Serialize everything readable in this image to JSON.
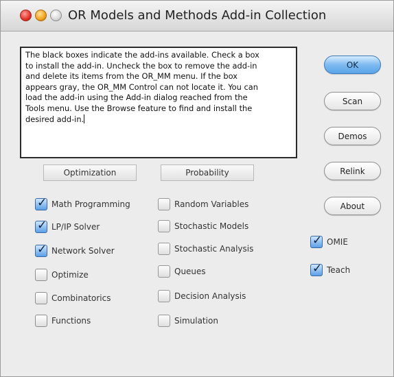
{
  "window": {
    "title": "OR Models and Methods Add-in Collection"
  },
  "info_lines": [
    "The black boxes indicate the add-ins available. Check a box",
    "to install the add-in.  Uncheck the box to remove the add-in",
    "and delete its items from the OR_MM menu.  If the box",
    "appears gray, the OR_MM Control can not locate it. You can",
    "load the add-in using the Add-in dialog reached from the",
    "Tools menu.  Use the Browse feature to find and install the",
    "desired add-in."
  ],
  "groups": {
    "optimization": "Optimization",
    "probability": "Probability"
  },
  "optimization_items": [
    {
      "label": "Math Programming",
      "checked": true
    },
    {
      "label": "LP/IP Solver",
      "checked": true
    },
    {
      "label": "Network Solver",
      "checked": true
    },
    {
      "label": "Optimize",
      "checked": false
    },
    {
      "label": "Combinatorics",
      "checked": false
    },
    {
      "label": "Functions",
      "checked": false
    }
  ],
  "probability_items": [
    {
      "label": "Random Variables",
      "checked": false
    },
    {
      "label": "Stochastic Models",
      "checked": false
    },
    {
      "label": "Stochastic Analysis",
      "checked": false
    },
    {
      "label": "Queues",
      "checked": false
    },
    {
      "label": "Decision Analysis",
      "checked": false
    },
    {
      "label": "Simulation",
      "checked": false
    }
  ],
  "side_buttons": {
    "ok": "OK",
    "scan": "Scan",
    "demos": "Demos",
    "relink": "Relink",
    "about": "About"
  },
  "extras": [
    {
      "label": "OMIE",
      "checked": true
    },
    {
      "label": "Teach",
      "checked": true
    }
  ]
}
